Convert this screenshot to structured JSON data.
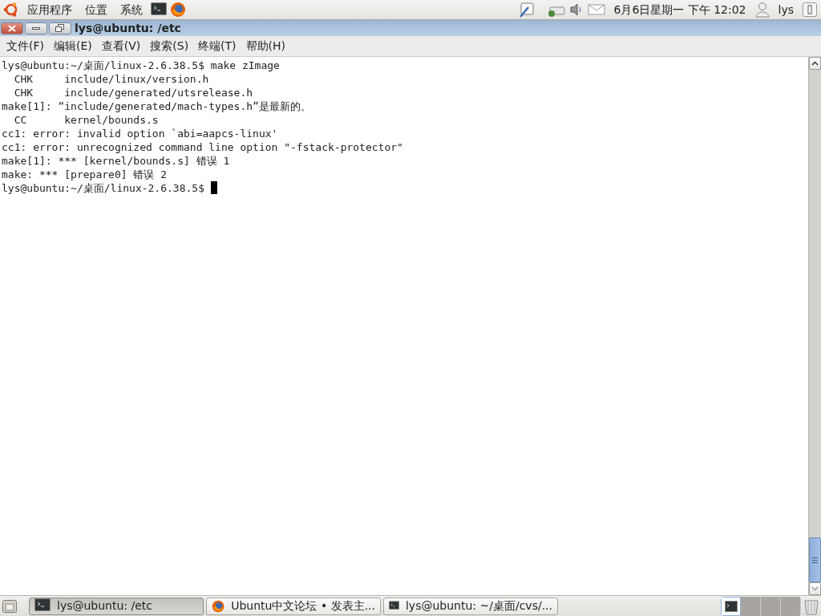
{
  "top_panel": {
    "menus": [
      "应用程序",
      "位置",
      "系统"
    ],
    "clock": "6月6日星期一 下午 12:02",
    "user": "lys"
  },
  "window": {
    "title": "lys@ubuntu: /etc",
    "menu": [
      "文件(F)",
      "编辑(E)",
      "查看(V)",
      "搜索(S)",
      "终端(T)",
      "帮助(H)"
    ]
  },
  "terminal": {
    "lines": [
      "lys@ubuntu:~/桌面/linux-2.6.38.5$ make zImage",
      "  CHK     include/linux/version.h",
      "  CHK     include/generated/utsrelease.h",
      "make[1]: “include/generated/mach-types.h”是最新的。",
      "  CC      kernel/bounds.s",
      "cc1: error: invalid option `abi=aapcs-linux'",
      "cc1: error: unrecognized command line option \"-fstack-protector\"",
      "make[1]: *** [kernel/bounds.s] 错误 1",
      "make: *** [prepare0] 错误 2",
      "lys@ubuntu:~/桌面/linux-2.6.38.5$ "
    ],
    "cursor": true
  },
  "taskbar": {
    "tasks": [
      {
        "label": "lys@ubuntu: /etc",
        "kind": "terminal",
        "selected": true
      },
      {
        "label": "Ubuntu中文论坛 • 发表主...",
        "kind": "browser",
        "selected": false
      },
      {
        "label": "lys@ubuntu: ~/桌面/cvs/...",
        "kind": "terminal",
        "selected": false
      }
    ],
    "workspaces": [
      {
        "selected": true
      },
      {
        "selected": false
      },
      {
        "selected": false
      },
      {
        "selected": false
      }
    ]
  }
}
